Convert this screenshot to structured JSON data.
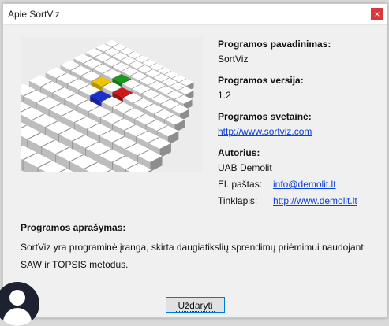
{
  "window": {
    "title": "Apie SortViz",
    "close_glyph": "×"
  },
  "about": {
    "name_label": "Programos pavadinimas:",
    "name_value": "SortViz",
    "version_label": "Programos versija:",
    "version_value": "1.2",
    "website_label": "Programos svetainė:",
    "website_link": "http://www.sortviz.com",
    "author_label": "Autorius:",
    "author_value": "UAB Demolit",
    "email_key": "El. paštas:",
    "email_link": "info@demolit.lt",
    "site_key": "Tinklapis:",
    "site_link": "http://www.demolit.lt"
  },
  "description": {
    "label": "Programos aprašymas:",
    "text": "SortViz yra programinė įranga, skirta daugiatikslių sprendimų priėmimui naudojant SAW ir TOPSIS metodus."
  },
  "buttons": {
    "close_label": "Uždaryti"
  },
  "colors": {
    "link": "#0a3fd8",
    "close": "#d9363e",
    "accent_cubes": [
      "#f0c400",
      "#1a2fd0",
      "#1a9a1a",
      "#d01818"
    ]
  },
  "icons": {
    "logo": "cube-grid-logo-icon",
    "avatar": "user-avatar-icon"
  }
}
